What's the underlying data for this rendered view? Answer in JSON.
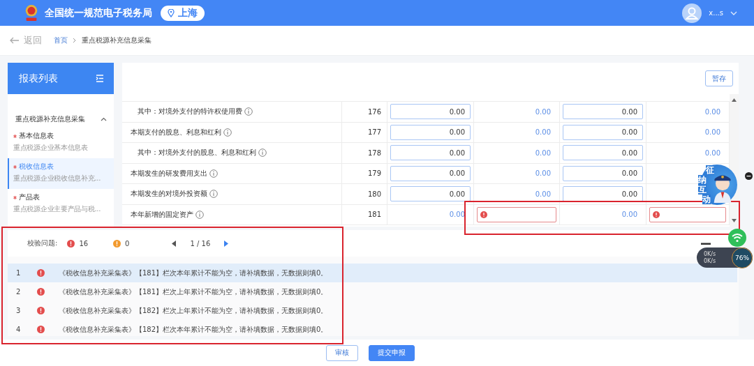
{
  "header": {
    "title": "全国统一规范电子税务局",
    "location": "上海",
    "user": "x...s"
  },
  "breadcrumb": {
    "back": "返回",
    "items": [
      "首页",
      "重点税源补充信息采集"
    ]
  },
  "sidebar": {
    "title": "报表列表",
    "group": {
      "label": "重点税源补充信息采集",
      "expanded": true
    },
    "items": [
      {
        "title": "基本信息表",
        "subtitle": "重点税源企业基本信息表",
        "required": true,
        "selected": false
      },
      {
        "title": "税收信息表",
        "subtitle": "重点税源企业税收信息补充...",
        "required": true,
        "selected": true
      },
      {
        "title": "产品表",
        "subtitle": "重点税源企业主要产品与税...",
        "required": true,
        "selected": false
      }
    ]
  },
  "toolbar": {
    "save": "暂存"
  },
  "table": {
    "rows": [
      {
        "kind": "sub",
        "label": "其中：对境外支付的特许权使用费",
        "line": "176",
        "cells": [
          {
            "kind": "input",
            "value": "0.00"
          },
          {
            "kind": "text",
            "value": "0.00"
          },
          {
            "kind": "input",
            "value": "0.00"
          },
          {
            "kind": "text",
            "value": "0.00"
          }
        ]
      },
      {
        "kind": "main",
        "label": "本期支付的股息、利息和红利",
        "line": "177",
        "cells": [
          {
            "kind": "input",
            "value": "0.00"
          },
          {
            "kind": "text",
            "value": "0.00"
          },
          {
            "kind": "input",
            "value": "0.00"
          },
          {
            "kind": "text",
            "value": "0.00"
          }
        ]
      },
      {
        "kind": "sub",
        "label": "其中：对境外支付的股息、利息和红利",
        "line": "178",
        "cells": [
          {
            "kind": "input",
            "value": "0.00"
          },
          {
            "kind": "text",
            "value": "0.00"
          },
          {
            "kind": "input",
            "value": "0.00"
          },
          {
            "kind": "text",
            "value": "0.00"
          }
        ]
      },
      {
        "kind": "main",
        "label": "本期发生的研发费用支出",
        "line": "179",
        "cells": [
          {
            "kind": "input",
            "value": "0.00"
          },
          {
            "kind": "text",
            "value": "0.00"
          },
          {
            "kind": "input",
            "value": "0.00"
          },
          {
            "kind": "text"
          }
        ]
      },
      {
        "kind": "main",
        "label": "本期发生的对境外投资额",
        "line": "180",
        "cells": [
          {
            "kind": "input",
            "value": "0.00"
          },
          {
            "kind": "text",
            "value": "0.00"
          },
          {
            "kind": "input",
            "value": "0.00"
          },
          {
            "kind": "text"
          }
        ]
      },
      {
        "kind": "main",
        "label": "本年新增的固定资产",
        "line": "181",
        "cells": [
          {
            "kind": "text",
            "value": "0.00"
          },
          {
            "kind": "error"
          },
          {
            "kind": "text",
            "value": "0.00"
          },
          {
            "kind": "error"
          }
        ]
      }
    ]
  },
  "validation": {
    "label": "校验问题:",
    "errors": "16",
    "warnings": "0",
    "pager": "1 / 16",
    "messages": [
      {
        "number": "1",
        "text": "《税收信息补充采集表》【181】栏次本年累计不能为空，请补填数据，无数据则填0。",
        "selected": true
      },
      {
        "number": "2",
        "text": "《税收信息补充采集表》【181】栏次上年累计不能为空，请补填数据，无数据则填0。",
        "selected": false
      },
      {
        "number": "3",
        "text": "《税收信息补充采集表》【182】栏次上年累计不能为空，请补填数据，无数据则填0。",
        "selected": false
      },
      {
        "number": "4",
        "text": "《税收信息补充采集表》【182】栏次本年累计不能为空，请补填数据，无数据则填0。",
        "selected": false
      }
    ]
  },
  "actions": [
    "审核",
    "提交申报"
  ],
  "assistant": {
    "label": [
      "征",
      "纳",
      "互",
      "动"
    ]
  },
  "monitor": {
    "upload": "0K/s",
    "download": "0K/s",
    "load": "76%"
  }
}
